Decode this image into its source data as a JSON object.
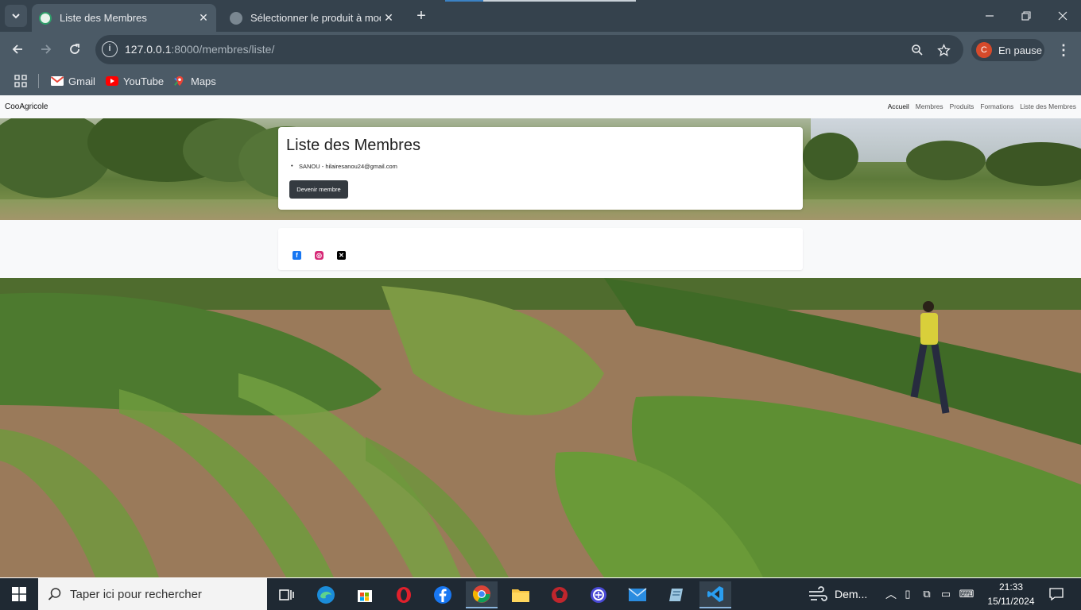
{
  "browser": {
    "tabs": [
      {
        "title": "Liste des Membres",
        "active": true
      },
      {
        "title": "Sélectionner le produit à modifier",
        "active": false
      }
    ],
    "url_host": "127.0.0.1",
    "url_rest": ":8000/membres/liste/",
    "profile_initial": "C",
    "profile_label": "En pause",
    "bookmarks": [
      {
        "label": "Gmail"
      },
      {
        "label": "YouTube"
      },
      {
        "label": "Maps"
      }
    ]
  },
  "site": {
    "brand": "CooAgricole",
    "nav": [
      "Accueil",
      "Membres",
      "Produits",
      "Formations",
      "Liste des Membres"
    ],
    "heading": "Liste des Membres",
    "members": [
      "SANOU - hilairesanou24@gmail.com"
    ],
    "join_button": "Devenir membre",
    "social": [
      "facebook-icon",
      "instagram-icon",
      "x-icon"
    ]
  },
  "taskbar": {
    "search_placeholder": "Taper ici pour rechercher",
    "weather_label": "Dem...",
    "time": "21:33",
    "date": "15/11/2024"
  },
  "colors": {
    "chrome_dark": "#35424d",
    "chrome_light": "#4b5a66",
    "button_dark": "#343a40",
    "taskbar": "#1f2933"
  }
}
